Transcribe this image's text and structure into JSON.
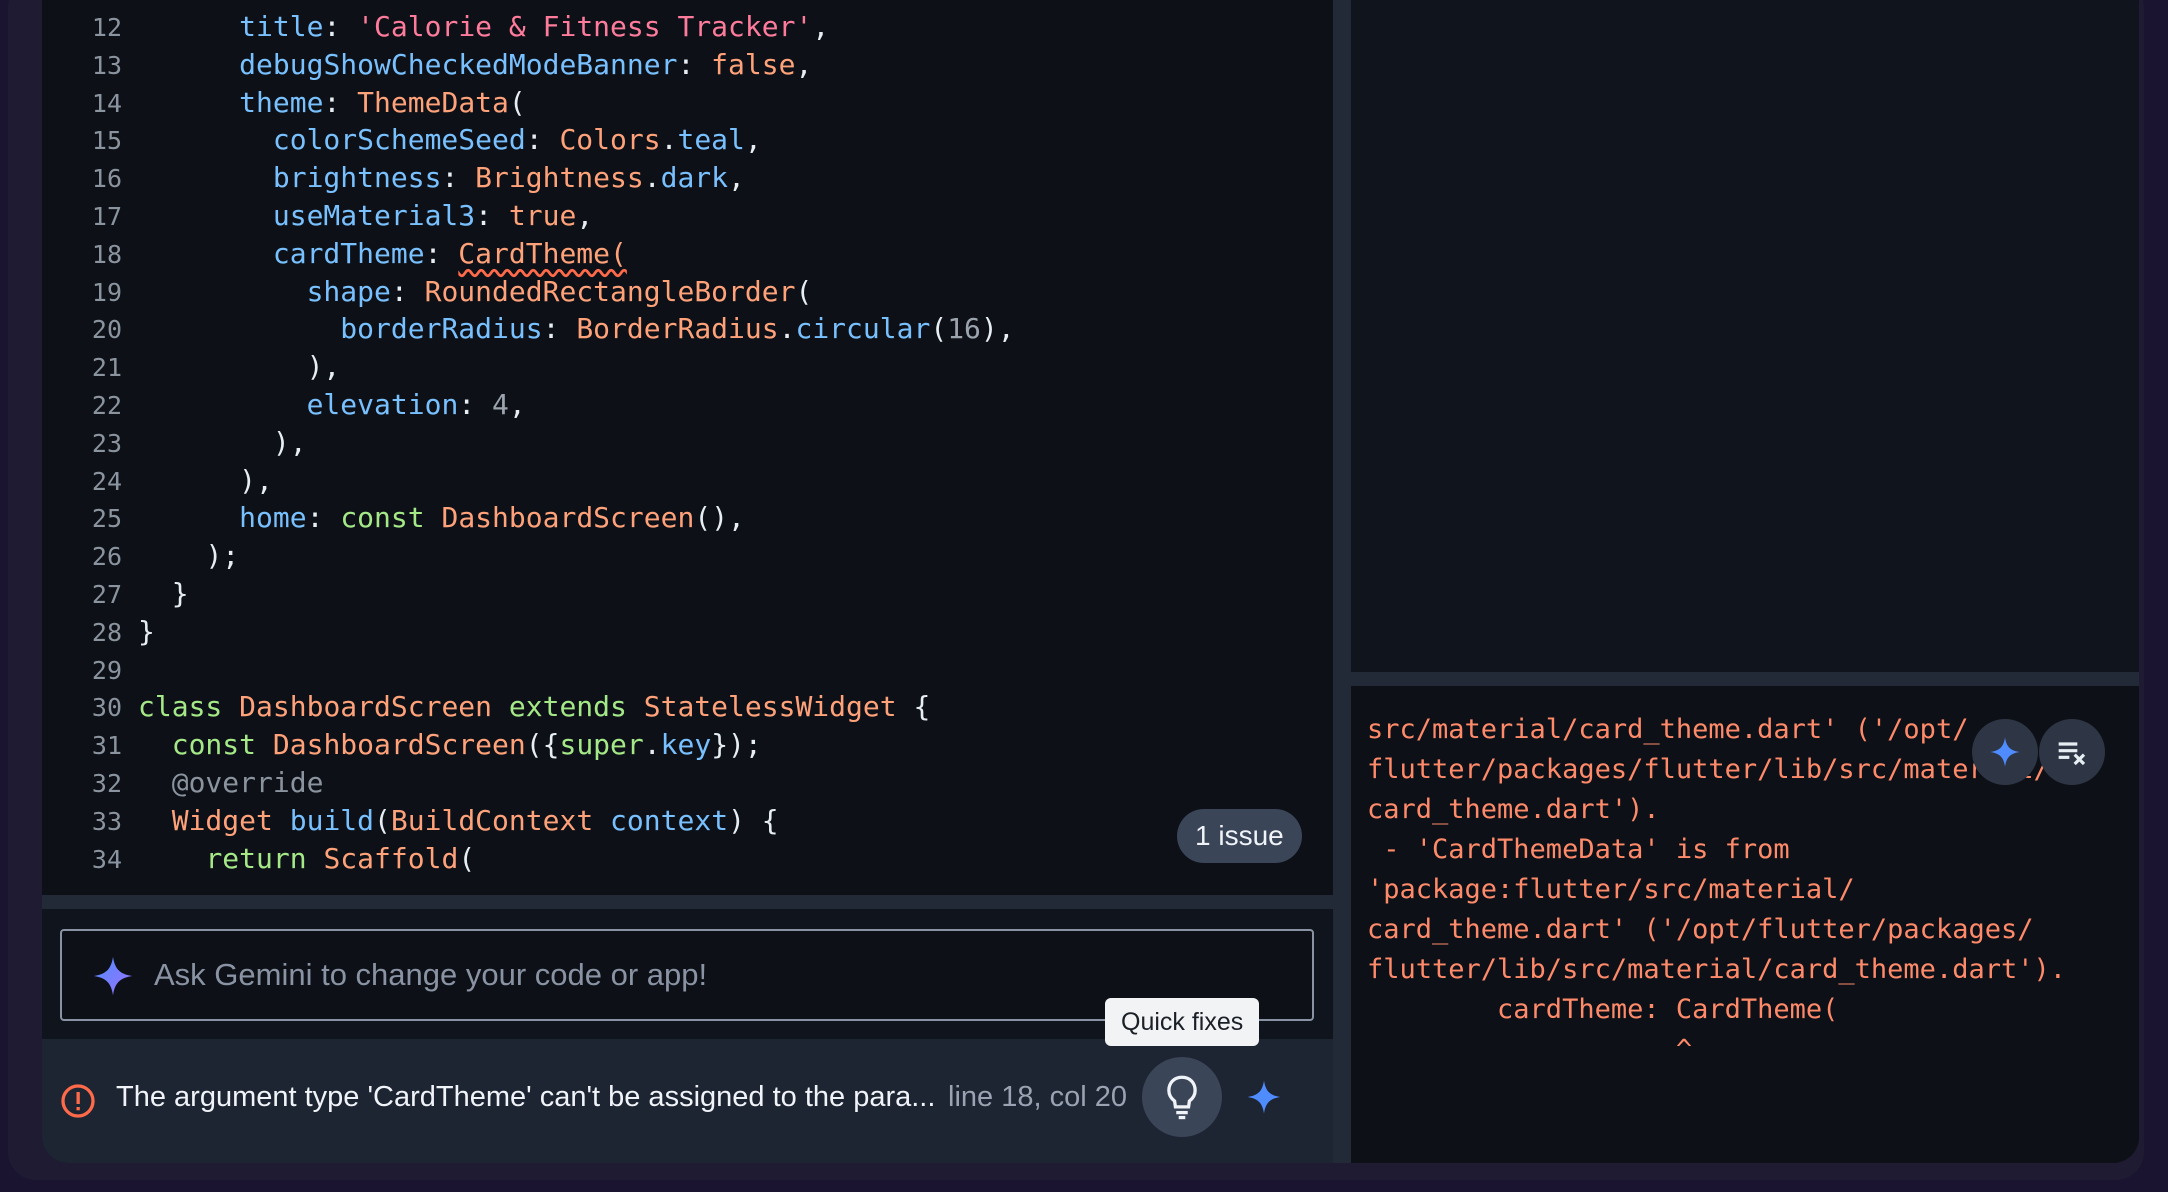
{
  "editor": {
    "lines": [
      {
        "n": "12",
        "indent": 6,
        "tokens": [
          {
            "t": "title",
            "c": "prop"
          },
          {
            "t": ": ",
            "c": "c-text"
          },
          {
            "t": "'Calorie & Fitness Tracker'",
            "c": "str"
          },
          {
            "t": ",",
            "c": "c-text"
          }
        ]
      },
      {
        "n": "13",
        "indent": 6,
        "tokens": [
          {
            "t": "debugShowCheckedModeBanner",
            "c": "prop"
          },
          {
            "t": ": ",
            "c": "c-text"
          },
          {
            "t": "false",
            "c": "bool"
          },
          {
            "t": ",",
            "c": "c-text"
          }
        ]
      },
      {
        "n": "14",
        "indent": 6,
        "tokens": [
          {
            "t": "theme",
            "c": "prop"
          },
          {
            "t": ": ",
            "c": "c-text"
          },
          {
            "t": "ThemeData",
            "c": "cls"
          },
          {
            "t": "(",
            "c": "c-text"
          }
        ]
      },
      {
        "n": "15",
        "indent": 8,
        "tokens": [
          {
            "t": "colorSchemeSeed",
            "c": "prop"
          },
          {
            "t": ": ",
            "c": "c-text"
          },
          {
            "t": "Colors",
            "c": "cls"
          },
          {
            "t": ".",
            "c": "c-text"
          },
          {
            "t": "teal",
            "c": "prop"
          },
          {
            "t": ",",
            "c": "c-text"
          }
        ]
      },
      {
        "n": "16",
        "indent": 8,
        "tokens": [
          {
            "t": "brightness",
            "c": "prop"
          },
          {
            "t": ": ",
            "c": "c-text"
          },
          {
            "t": "Brightness",
            "c": "cls"
          },
          {
            "t": ".",
            "c": "c-text"
          },
          {
            "t": "dark",
            "c": "prop"
          },
          {
            "t": ",",
            "c": "c-text"
          }
        ]
      },
      {
        "n": "17",
        "indent": 8,
        "tokens": [
          {
            "t": "useMaterial3",
            "c": "prop"
          },
          {
            "t": ": ",
            "c": "c-text"
          },
          {
            "t": "true",
            "c": "bool"
          },
          {
            "t": ",",
            "c": "c-text"
          }
        ]
      },
      {
        "n": "18",
        "indent": 8,
        "tokens": [
          {
            "t": "cardTheme",
            "c": "prop"
          },
          {
            "t": ": ",
            "c": "c-text"
          },
          {
            "t": "CardTheme(",
            "c": "cls squiggle"
          }
        ]
      },
      {
        "n": "19",
        "indent": 10,
        "tokens": [
          {
            "t": "shape",
            "c": "prop"
          },
          {
            "t": ": ",
            "c": "c-text"
          },
          {
            "t": "RoundedRectangleBorder",
            "c": "cls"
          },
          {
            "t": "(",
            "c": "c-text"
          }
        ]
      },
      {
        "n": "20",
        "indent": 12,
        "tokens": [
          {
            "t": "borderRadius",
            "c": "prop"
          },
          {
            "t": ": ",
            "c": "c-text"
          },
          {
            "t": "BorderRadius",
            "c": "cls"
          },
          {
            "t": ".",
            "c": "c-text"
          },
          {
            "t": "circular",
            "c": "prop"
          },
          {
            "t": "(",
            "c": "c-text"
          },
          {
            "t": "16",
            "c": "num"
          },
          {
            "t": "),",
            "c": "c-text"
          }
        ]
      },
      {
        "n": "21",
        "indent": 10,
        "tokens": [
          {
            "t": "),",
            "c": "c-text"
          }
        ]
      },
      {
        "n": "22",
        "indent": 10,
        "tokens": [
          {
            "t": "elevation",
            "c": "prop"
          },
          {
            "t": ": ",
            "c": "c-text"
          },
          {
            "t": "4",
            "c": "num"
          },
          {
            "t": ",",
            "c": "c-text"
          }
        ]
      },
      {
        "n": "23",
        "indent": 8,
        "tokens": [
          {
            "t": "),",
            "c": "c-text"
          }
        ]
      },
      {
        "n": "24",
        "indent": 6,
        "tokens": [
          {
            "t": "),",
            "c": "c-text"
          }
        ]
      },
      {
        "n": "25",
        "indent": 6,
        "tokens": [
          {
            "t": "home",
            "c": "prop"
          },
          {
            "t": ": ",
            "c": "c-text"
          },
          {
            "t": "const ",
            "c": "kw"
          },
          {
            "t": "DashboardScreen",
            "c": "cls"
          },
          {
            "t": "(),",
            "c": "c-text"
          }
        ]
      },
      {
        "n": "26",
        "indent": 4,
        "tokens": [
          {
            "t": ");",
            "c": "c-text"
          }
        ]
      },
      {
        "n": "27",
        "indent": 2,
        "tokens": [
          {
            "t": "}",
            "c": "c-text"
          }
        ]
      },
      {
        "n": "28",
        "indent": 0,
        "tokens": [
          {
            "t": "}",
            "c": "c-text"
          }
        ]
      },
      {
        "n": "29",
        "indent": 0,
        "tokens": []
      },
      {
        "n": "30",
        "indent": 0,
        "tokens": [
          {
            "t": "class ",
            "c": "kw"
          },
          {
            "t": "DashboardScreen ",
            "c": "cls"
          },
          {
            "t": "extends ",
            "c": "kw"
          },
          {
            "t": "StatelessWidget ",
            "c": "cls"
          },
          {
            "t": "{",
            "c": "c-text"
          }
        ]
      },
      {
        "n": "31",
        "indent": 2,
        "tokens": [
          {
            "t": "const ",
            "c": "kw"
          },
          {
            "t": "DashboardScreen",
            "c": "cls"
          },
          {
            "t": "({",
            "c": "c-text"
          },
          {
            "t": "super",
            "c": "kw"
          },
          {
            "t": ".",
            "c": "c-text"
          },
          {
            "t": "key",
            "c": "prop"
          },
          {
            "t": "});",
            "c": "c-text"
          }
        ]
      },
      {
        "n": "32",
        "indent": 2,
        "tokens": [
          {
            "t": "@override",
            "c": "ann"
          }
        ]
      },
      {
        "n": "33",
        "indent": 2,
        "tokens": [
          {
            "t": "Widget ",
            "c": "cls"
          },
          {
            "t": "build",
            "c": "prop"
          },
          {
            "t": "(",
            "c": "c-text"
          },
          {
            "t": "BuildContext ",
            "c": "cls"
          },
          {
            "t": "context",
            "c": "prop"
          },
          {
            "t": ") {",
            "c": "c-text"
          }
        ]
      },
      {
        "n": "34",
        "indent": 4,
        "tokens": [
          {
            "t": "return ",
            "c": "kw"
          },
          {
            "t": "Scaffold",
            "c": "cls"
          },
          {
            "t": "(",
            "c": "c-text"
          }
        ]
      }
    ],
    "issue_badge": "1 issue"
  },
  "gemini": {
    "placeholder": "Ask Gemini to change your code or app!"
  },
  "status_bar": {
    "message": "The argument type 'CardTheme' can't be assigned to the para...",
    "position": "line 18, col 20",
    "tooltip": "Quick fixes"
  },
  "console": {
    "lines": [
      "src/material/card_theme.dart' ('/opt/",
      "flutter/packages/flutter/lib/src/material/",
      "card_theme.dart').",
      " - 'CardThemeData' is from",
      "'package:flutter/src/material/",
      "card_theme.dart' ('/opt/flutter/packages/",
      "flutter/lib/src/material/card_theme.dart').",
      "        cardTheme: CardTheme(",
      "                   ^"
    ]
  },
  "colors": {
    "error": "#ff6b4a",
    "accent": "#4f8cff",
    "background": "#0d1117"
  },
  "icons": {
    "editor_error": "error-circle-icon",
    "quick_fix": "lightbulb-icon",
    "gemini": "gemini-sparkle-icon",
    "clear_console": "clear-all-icon"
  }
}
